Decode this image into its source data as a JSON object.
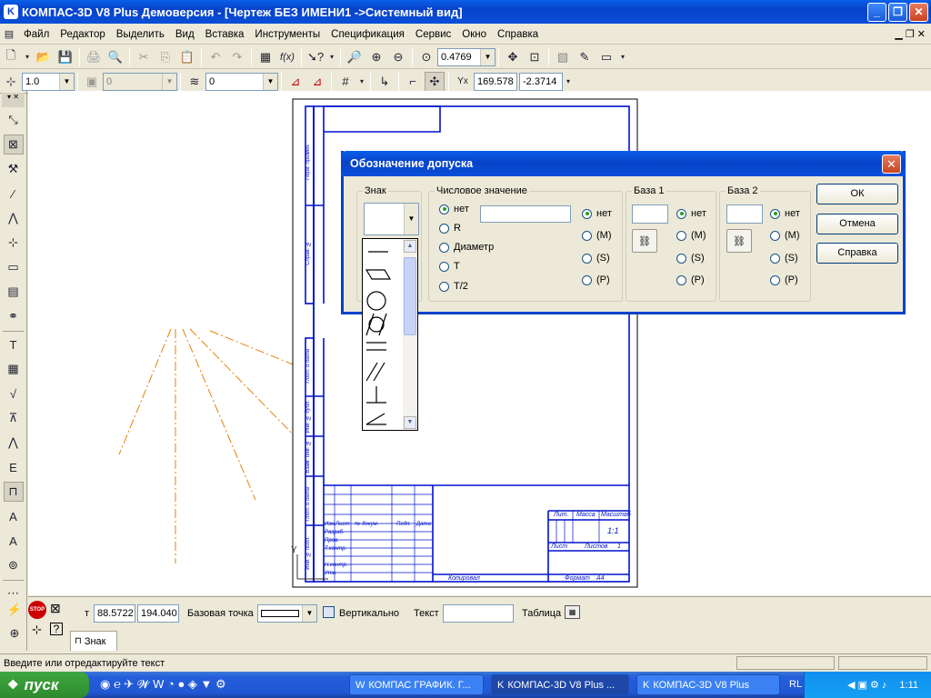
{
  "window": {
    "title": "КОМПАС-3D V8 Plus Демоверсия - [Чертеж БЕЗ ИМЕНИ1 ->Системный вид]",
    "controls": [
      "minimize",
      "restore",
      "close"
    ]
  },
  "menu": {
    "items": [
      "Файл",
      "Редактор",
      "Выделить",
      "Вид",
      "Вставка",
      "Инструменты",
      "Спецификация",
      "Сервис",
      "Окно",
      "Справка"
    ]
  },
  "toolbar1": {
    "zoom_value": "0.4769"
  },
  "toolbar2": {
    "step_value": "1.0",
    "layer_value_disabled": "0",
    "style_value": "0",
    "coord_x": "169.578",
    "coord_y": "-2.3714"
  },
  "drawing": {
    "stamp_labels": {
      "lit": "Лит.",
      "massa": "Масса",
      "masshtab": "Масштаб",
      "scale_value": "1:1",
      "list": "Лист",
      "listov": "Листов",
      "listov_value": "1",
      "kopiroval": "Копировал",
      "format": "Формат",
      "format_value": "А4",
      "izm": "Изм",
      "list_small": "Лист",
      "ndokum": "№ докум.",
      "podp": "Подп.",
      "data": "Дата",
      "razrab": "Разраб.",
      "prov": "Пров.",
      "tkontr": "Т.контр.",
      "nkontr": "Н.контр.",
      "utv": "Утв."
    },
    "side_labels": [
      "Перв. примен.",
      "Справ. №",
      "Подп. и дата",
      "Инв. № дубл.",
      "Взам. инв. №",
      "Подп. и дата",
      "Инв. № подл."
    ],
    "axis_label": "Y"
  },
  "dialog": {
    "title": "Обозначение допуска",
    "znak": {
      "legend": "Знак",
      "symbols": [
        "straightness",
        "flatness",
        "circularity",
        "cylindricity",
        "parallelism",
        "parallelism-double",
        "perpendicularity",
        "angularity"
      ]
    },
    "value": {
      "legend": "Числовое значение",
      "options": [
        "нет",
        "R",
        "Диаметр",
        "T",
        "T/2"
      ],
      "selected": 0,
      "input": "",
      "modifiers": [
        "нет",
        "(M)",
        "(S)",
        "(P)"
      ],
      "modifier_selected": 0
    },
    "baza1": {
      "legend": "База 1",
      "input": "",
      "modifiers": [
        "нет",
        "(M)",
        "(S)",
        "(P)"
      ],
      "selected": 0
    },
    "baza2": {
      "legend": "База 2",
      "input": "",
      "modifiers": [
        "нет",
        "(M)",
        "(S)",
        "(P)"
      ],
      "selected": 0
    },
    "buttons": {
      "ok": "ОК",
      "cancel": "Отмена",
      "help": "Справка"
    }
  },
  "propbar": {
    "t_label": "т",
    "x_value": "88.5722",
    "y_value": "194.040",
    "base_point_label": "Базовая точка",
    "vertical_label": "Вертикально",
    "text_label": "Текст",
    "text_value": "",
    "table_label": "Таблица",
    "tab_label": "Знак"
  },
  "status": {
    "text": "Введите или отредактируйте текст"
  },
  "taskbar": {
    "start_label": "пуск",
    "tasks": [
      "КОМПАС ГРАФИК. Г...",
      "КОМПАС-3D V8 Plus ...",
      "КОМПАС-3D V8 Plus"
    ],
    "lang": "RL",
    "clock": "1:11"
  }
}
